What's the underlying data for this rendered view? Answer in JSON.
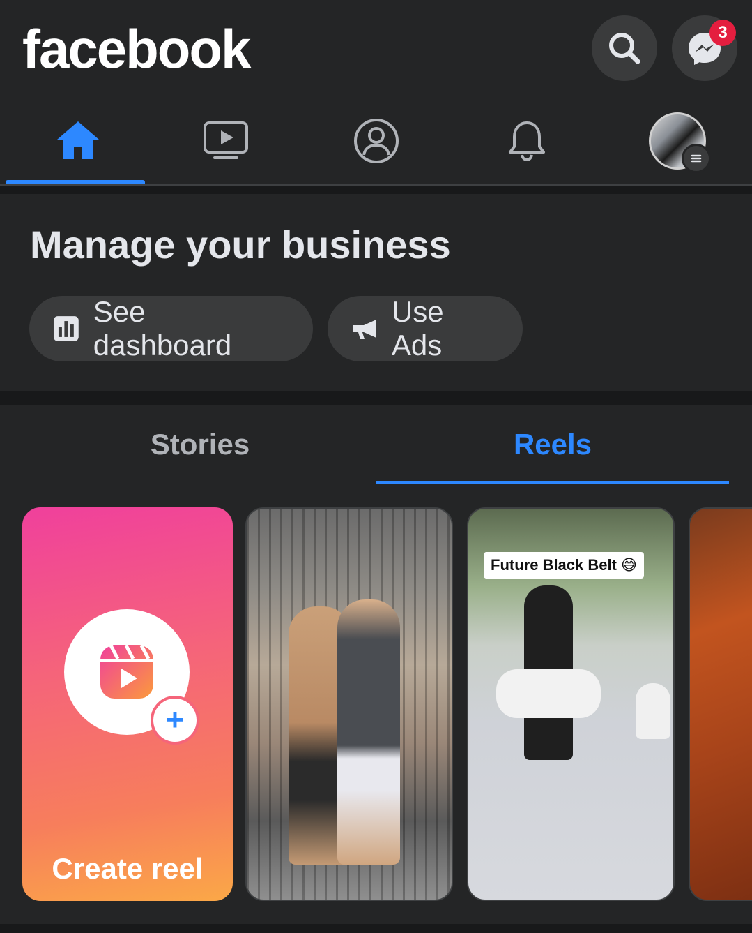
{
  "header": {
    "brand": "facebook",
    "search_icon": "search-icon",
    "messenger_icon": "messenger-icon",
    "messenger_badge": "3",
    "badge_color": "#e41e3f"
  },
  "nav": {
    "tabs": [
      {
        "name": "home",
        "icon": "home-icon",
        "active": true
      },
      {
        "name": "watch",
        "icon": "video-icon",
        "active": false
      },
      {
        "name": "profile",
        "icon": "profile-icon",
        "active": false
      },
      {
        "name": "notifications",
        "icon": "bell-icon",
        "active": false
      },
      {
        "name": "menu",
        "icon": "avatar-menu-icon",
        "active": false
      }
    ],
    "accent": "#2d88ff"
  },
  "business": {
    "title": "Manage your business",
    "see_dashboard": "See dashboard",
    "use_ads": "Use Ads"
  },
  "media_tabs": {
    "stories": "Stories",
    "reels": "Reels",
    "active": "reels"
  },
  "reels": {
    "create_label": "Create reel",
    "items": [
      {
        "caption": ""
      },
      {
        "caption": "Future Black Belt 😅"
      },
      {
        "caption": ""
      }
    ]
  }
}
